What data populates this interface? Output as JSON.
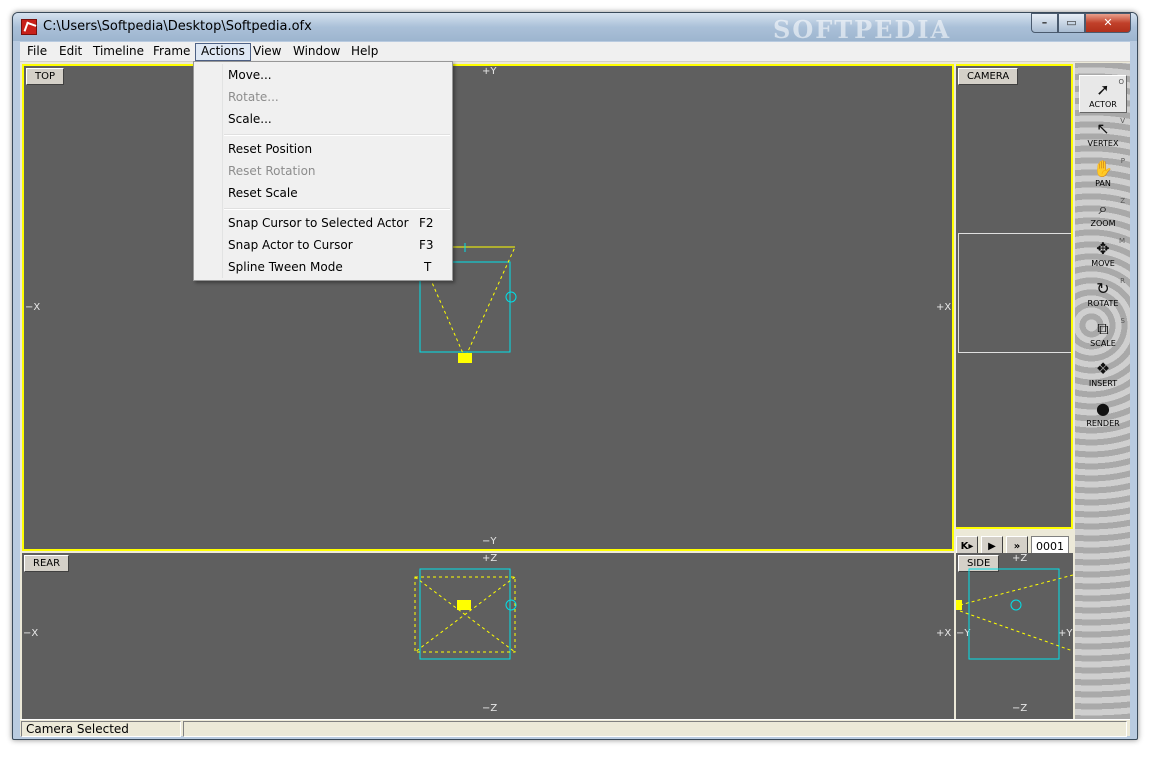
{
  "window": {
    "title": "C:\\Users\\Softpedia\\Desktop\\Softpedia.ofx",
    "watermark": "SOFTPEDIA",
    "min_glyph": "–",
    "max_glyph": "▭",
    "close_glyph": "✕"
  },
  "menubar": [
    "File",
    "Edit",
    "Timeline",
    "Frame",
    "Actions",
    "View",
    "Window",
    "Help"
  ],
  "actions_menu": {
    "items": [
      {
        "label": "Move...",
        "shortcut": "",
        "enabled": true
      },
      {
        "label": "Rotate...",
        "shortcut": "",
        "enabled": false
      },
      {
        "label": "Scale...",
        "shortcut": "",
        "enabled": true
      },
      {
        "label": "Reset Position",
        "shortcut": "",
        "enabled": true
      },
      {
        "label": "Reset Rotation",
        "shortcut": "",
        "enabled": false
      },
      {
        "label": "Reset Scale",
        "shortcut": "",
        "enabled": true
      },
      {
        "label": "Snap Cursor to Selected Actor",
        "shortcut": "F2",
        "enabled": true
      },
      {
        "label": "Snap Actor to Cursor",
        "shortcut": "F3",
        "enabled": true
      },
      {
        "label": "Spline Tween Mode",
        "shortcut": "T",
        "enabled": true
      }
    ]
  },
  "viewports": {
    "top": {
      "label": "TOP",
      "axis_top": "+Y",
      "axis_bottom": "−Y",
      "axis_left": "−X",
      "axis_right": "+X"
    },
    "camera": {
      "label": "CAMERA"
    },
    "rear": {
      "label": "REAR",
      "axis_top": "+Z",
      "axis_bottom": "−Z",
      "axis_left": "−X",
      "axis_right": "+X"
    },
    "side": {
      "label": "SIDE",
      "axis_top": "+Z",
      "axis_bottom": "−Z",
      "axis_left": "−Y",
      "axis_right": "+Y"
    }
  },
  "tools": [
    {
      "label": "ACTOR",
      "key": "O",
      "icon": "arrow-cursor-icon",
      "glyph": "➚"
    },
    {
      "label": "VERTEX",
      "key": "V",
      "icon": "vertex-cursor-icon",
      "glyph": "↖"
    },
    {
      "label": "PAN",
      "key": "P",
      "icon": "hand-icon",
      "glyph": "✋"
    },
    {
      "label": "ZOOM",
      "key": "Z",
      "icon": "magnifier-icon",
      "glyph": "⌕"
    },
    {
      "label": "MOVE",
      "key": "M",
      "icon": "move-arrows-icon",
      "glyph": "✥"
    },
    {
      "label": "ROTATE",
      "key": "R",
      "icon": "rotate-icon",
      "glyph": "↻"
    },
    {
      "label": "SCALE",
      "key": "S",
      "icon": "scale-icon",
      "glyph": "⧉"
    },
    {
      "label": "INSERT",
      "key": "",
      "icon": "insert-icon",
      "glyph": "❖"
    },
    {
      "label": "RENDER",
      "key": "",
      "icon": "render-icon",
      "glyph": "●"
    }
  ],
  "transport": {
    "first": "K▸",
    "play": "▶",
    "next": "»",
    "frame": "0001"
  },
  "status": {
    "message": "Camera Selected"
  },
  "colors": {
    "selection": "#ffff00",
    "cyan": "#00e0e8",
    "viewport_bg": "#5f5f5f"
  }
}
